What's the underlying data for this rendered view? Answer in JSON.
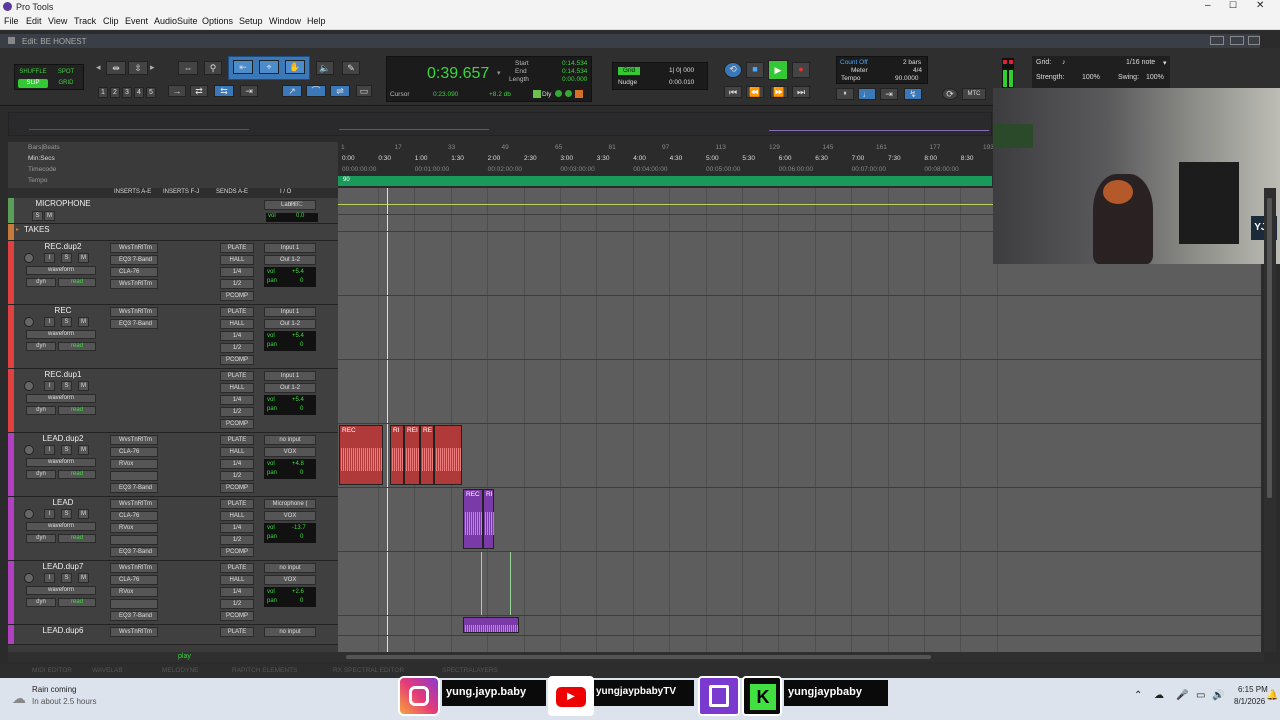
{
  "app": {
    "title": "Pro Tools",
    "window_title": "Edit: BE HONEST"
  },
  "menu": [
    "File",
    "Edit",
    "View",
    "Track",
    "Clip",
    "Event",
    "AudioSuite",
    "Options",
    "Setup",
    "Window",
    "Help"
  ],
  "edit_modes": {
    "shuffle": "SHUFFLE",
    "spot": "SPOT",
    "slip": "SLIP",
    "grid": "GRID"
  },
  "zoom_presets": [
    "1",
    "2",
    "3",
    "4",
    "5"
  ],
  "counter": {
    "main": "0:39.657",
    "start_label": "Start",
    "start": "0:14.534",
    "end_label": "End",
    "end": "0:14.534",
    "length_label": "Length",
    "length": "0:00.000",
    "cursor_label": "Cursor",
    "cursor": "0:23.090",
    "db": "+8.2 db",
    "dly": "Dly"
  },
  "grid_nudge": {
    "grid_label": "Grid",
    "grid_value": "1| 0| 000",
    "nudge_label": "Nudge",
    "nudge_value": "0:00.010"
  },
  "counts": {
    "count_off": "Count Off",
    "count_off_value": "2 bars",
    "meter_label": "Meter",
    "meter_value": "4/4",
    "tempo_label": "Tempo",
    "tempo_value": "90.0000"
  },
  "midi": {
    "mtc": "MTC"
  },
  "right_grid": {
    "grid_label": "Grid:",
    "note": "1/16 note",
    "strength_label": "Strength:",
    "strength": "100%",
    "swing_label": "Swing:",
    "swing": "100%"
  },
  "rulers": {
    "labels": [
      "Bars|Beats",
      "Min:Secs",
      "Timecode",
      "Tempo"
    ],
    "bars": [
      "1",
      "17",
      "33",
      "49",
      "65",
      "81",
      "97",
      "113",
      "129",
      "145",
      "161",
      "177",
      "193"
    ],
    "minsecs": [
      "0:00",
      "0:30",
      "1:00",
      "1:30",
      "2:00",
      "2:30",
      "3:00",
      "3:30",
      "4:00",
      "4:30",
      "5:00",
      "5:30",
      "6:00",
      "6:30",
      "7:00",
      "7:30",
      "8:00",
      "8:30"
    ],
    "timecode": [
      "00:00:00:00",
      "00:01:00:00",
      "00:02:00:00",
      "00:03:00:00",
      "00:04:00:00",
      "00:05:00:00",
      "00:06:00:00",
      "00:07:00:00",
      "00:08:00:00"
    ],
    "tempo_marker": "90"
  },
  "column_headers": {
    "inserts_ae": "INSERTS A-E",
    "inserts_fj": "INSERTS F-J",
    "sends_ae": "SENDS A-E",
    "io": "I / O"
  },
  "tracks": [
    {
      "name": "MICROPHONE",
      "color": "#5aa05a",
      "height": 26,
      "type": "aux",
      "in": "LabHT",
      "rec": "REC",
      "vol": "0.0",
      "inserts": [],
      "sends": []
    },
    {
      "name": "TAKES",
      "color": "#c87a3c",
      "height": 17,
      "type": "folder",
      "inserts": [],
      "sends": []
    },
    {
      "name": "REC.dup2",
      "color": "#e04040",
      "height": 64,
      "type": "audio",
      "view": "waveform",
      "dyn": "dyn",
      "read": "read",
      "vol": "+5.4",
      "pan": "0",
      "inserts": [
        "WvsTnRlTm",
        "EQ3 7-Band",
        "CLA-76",
        "WvsTnRlTm"
      ],
      "sends": [
        "PLATE",
        "HALL",
        "1/4",
        "1/2",
        "PCOMP"
      ],
      "input": "Input 1",
      "output": "Out 1-2"
    },
    {
      "name": "REC",
      "color": "#e04040",
      "height": 64,
      "type": "audio",
      "view": "waveform",
      "dyn": "dyn",
      "read": "read",
      "vol": "+5.4",
      "pan": "0",
      "inserts": [
        "WvsTnRlTm",
        "EQ3 7-Band"
      ],
      "sends": [
        "PLATE",
        "HALL",
        "1/4",
        "1/2",
        "PCOMP"
      ],
      "input": "Input 1",
      "output": "Out 1-2"
    },
    {
      "name": "REC.dup1",
      "color": "#e04040",
      "height": 64,
      "type": "audio",
      "view": "waveform",
      "dyn": "dyn",
      "read": "read",
      "vol": "+5.4",
      "pan": "0",
      "inserts": [],
      "sends": [
        "PLATE",
        "HALL",
        "1/4",
        "1/2",
        "PCOMP"
      ],
      "input": "Input 1",
      "output": "Out 1-2"
    },
    {
      "name": "LEAD.dup2",
      "color": "#b040c0",
      "height": 64,
      "type": "audio",
      "view": "waveform",
      "dyn": "dyn",
      "read": "read",
      "vol": "+4.8",
      "pan": "0",
      "inserts": [
        "WvsTnRlTm",
        "CLA-76",
        "RVox",
        "",
        "EQ3 7-Band"
      ],
      "sends": [
        "PLATE",
        "HALL",
        "1/4",
        "1/2",
        "PCOMP"
      ],
      "input": "no input",
      "output": "VOX"
    },
    {
      "name": "LEAD",
      "color": "#b040c0",
      "height": 64,
      "type": "audio",
      "view": "waveform",
      "dyn": "dyn",
      "read": "read",
      "vol": "-13.7",
      "pan": "0",
      "inserts": [
        "WvsTnRlTm",
        "CLA-76",
        "RVox",
        "",
        "EQ3 7-Band"
      ],
      "sends": [
        "PLATE",
        "HALL",
        "1/4",
        "1/2",
        "PCOMP"
      ],
      "input": "Microphone (",
      "output": "VOX"
    },
    {
      "name": "LEAD.dup7",
      "color": "#b040c0",
      "height": 64,
      "type": "audio",
      "view": "waveform",
      "dyn": "dyn",
      "read": "read",
      "vol": "+2.6",
      "pan": "0",
      "inserts": [
        "WvsTnRlTm",
        "CLA-76",
        "RVox",
        "",
        "EQ3 7-Band"
      ],
      "sends": [
        "PLATE",
        "HALL",
        "1/4",
        "1/2",
        "PCOMP"
      ],
      "input": "no input",
      "output": "VOX"
    },
    {
      "name": "LEAD.dup6",
      "color": "#b040c0",
      "height": 20,
      "type": "audio",
      "inserts": [
        "WvsTnRlTm"
      ],
      "sends": [
        "PLATE"
      ],
      "input": "no input"
    }
  ],
  "clips": {
    "rec": "REC",
    "ri": "RI",
    "rei": "REI",
    "re": "RE",
    "rec2": "REC"
  },
  "status": {
    "play": "play"
  },
  "bottom_tabs": [
    "MIDI EDITOR",
    "WAVELAB",
    "MELODYNE",
    "RAPITCH ELEMENTS",
    "RX SPECTRAL EDITOR",
    "SPECTRALAYERS"
  ],
  "socials": {
    "instagram": "yung.jayp.baby",
    "youtube": "yungjaypbabyTV",
    "kick": "yungjaypbaby"
  },
  "webcam": {
    "badge": "YJB"
  },
  "taskbar": {
    "weather_title": "Rain coming",
    "weather_sub": "In about 2.5 hours",
    "time": "6:15 PM",
    "date": "8/1/2026"
  },
  "colors": {
    "accent_blue": "#3a78b8",
    "green": "#35c835",
    "counter_green": "#38d838",
    "clip_red": "#b03a3a",
    "clip_purple": "#7a3aa8",
    "tempo_green": "#1a9a5a"
  }
}
